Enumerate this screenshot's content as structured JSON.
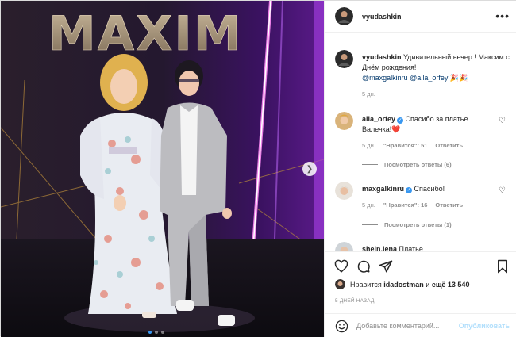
{
  "photo": {
    "sign_text": "MAXIM",
    "carousel_next_icon": "chevron-right-icon",
    "dots_count": 3,
    "active_dot": 0
  },
  "header": {
    "username": "vyudashkin",
    "more_icon": "more-horizontal-icon"
  },
  "caption": {
    "username": "vyudashkin",
    "text": "Удивительный вечер ! Максим с Днём рождения!",
    "mention1": "@maxgalkinru",
    "mention2": "@alla_orfey",
    "emoji": "🎉🎉",
    "time": "5 дн."
  },
  "comments": [
    {
      "username": "alla_orfey",
      "verified": true,
      "text": "Спасибо за платье Валечка!",
      "emoji": "❤️",
      "time": "5 дн.",
      "likes": "\"Нравится\": 51",
      "reply": "Ответить",
      "replies": "Посмотреть ответы (6)"
    },
    {
      "username": "maxgalkinru",
      "verified": true,
      "text": "Спасибо!",
      "time": "5 дн.",
      "likes": "\"Нравится\": 16",
      "reply": "Ответить",
      "replies": "Посмотреть ответы (1)"
    },
    {
      "username": "shein.lena",
      "verified": false,
      "text": "Платье"
    }
  ],
  "likes": {
    "prefix": "Нравится",
    "user": "idadostman",
    "and": "и",
    "more": "ещё 13 540"
  },
  "time_ago": "5 ДНЕЙ НАЗАД",
  "comment_box": {
    "placeholder": "Добавьте комментарий...",
    "publish": "Опубликовать"
  },
  "colors": {
    "accent": "#3897f0",
    "link": "#00376b",
    "muted": "#8e8e8e",
    "heart": "#ed4956",
    "publish_disabled": "#b2dffc"
  }
}
